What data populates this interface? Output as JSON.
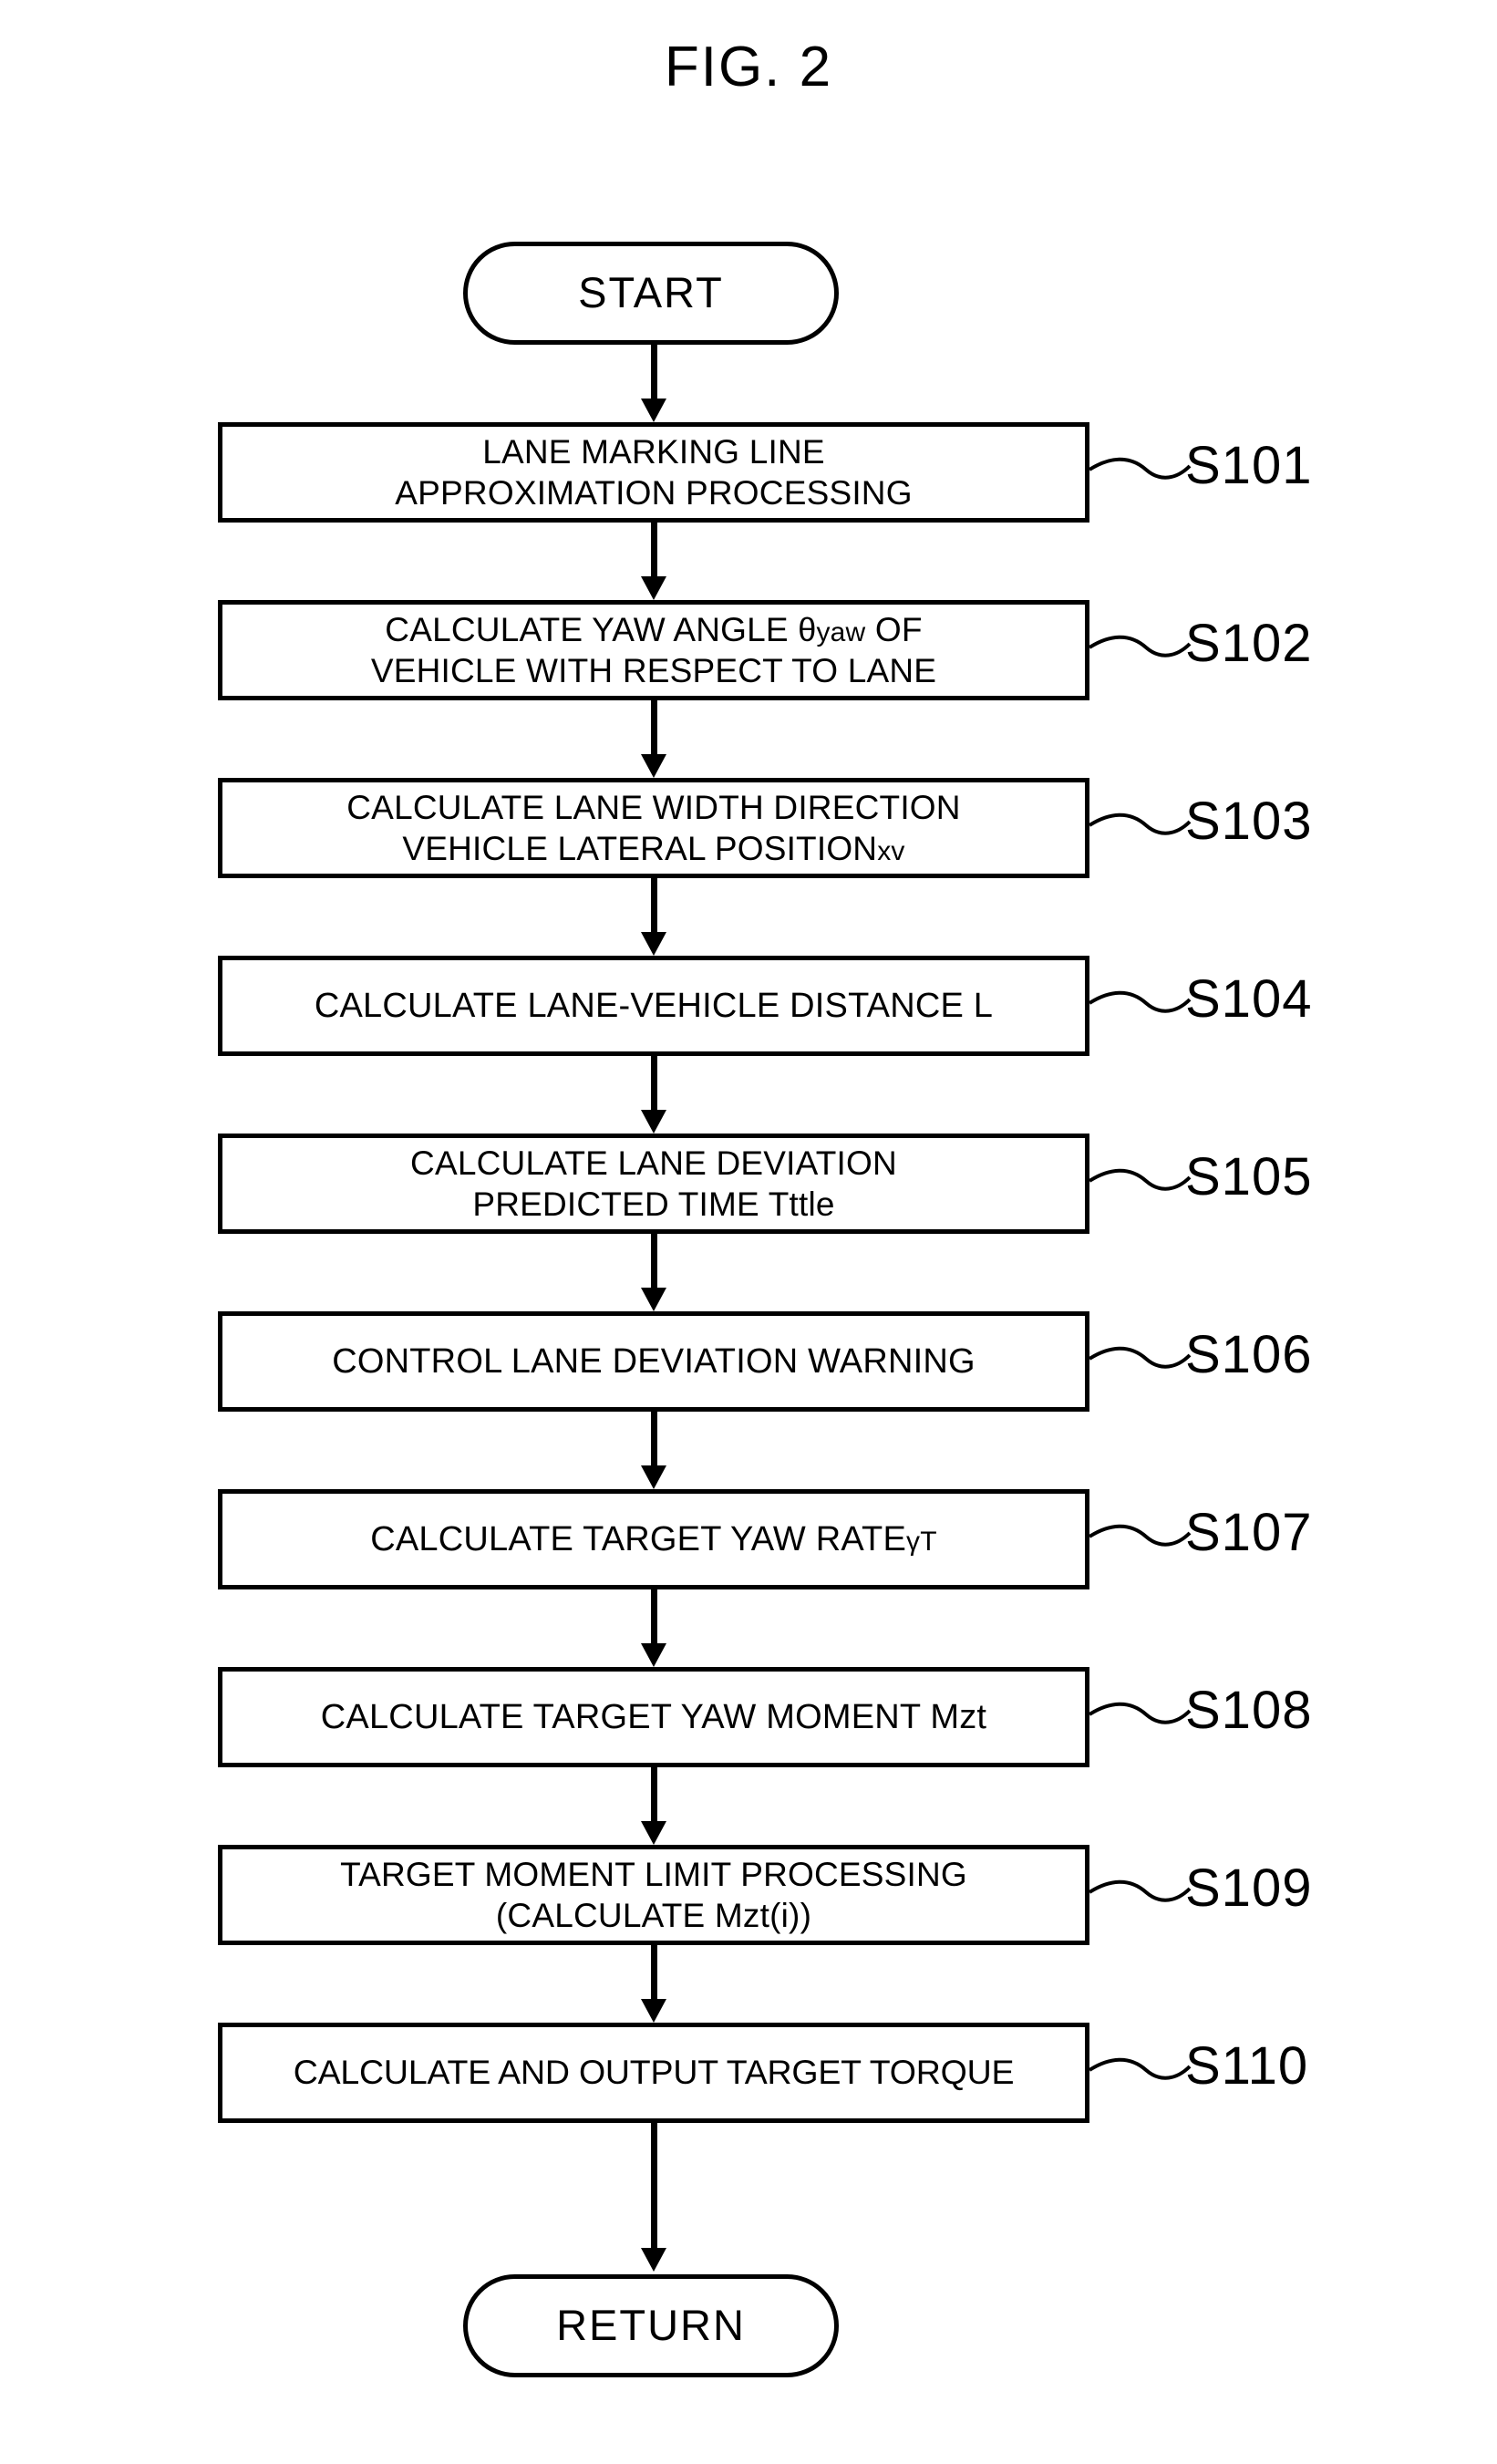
{
  "figure": {
    "title": "FIG. 2"
  },
  "flowchart": {
    "type": "flowchart",
    "orientation": "top-to-bottom",
    "start_label": "START",
    "end_label": "RETURN",
    "steps": [
      {
        "id": "S101",
        "lines": [
          "LANE MARKING LINE",
          "APPROXIMATION PROCESSING"
        ],
        "text": "LANE MARKING LINE APPROXIMATION PROCESSING"
      },
      {
        "id": "S102",
        "lines": [
          "CALCULATE YAW ANGLE θyaw OF",
          "VEHICLE WITH RESPECT TO LANE"
        ],
        "text": "CALCULATE YAW ANGLE θyaw OF VEHICLE WITH RESPECT TO LANE"
      },
      {
        "id": "S103",
        "lines": [
          "CALCULATE LANE WIDTH DIRECTION",
          "VEHICLE LATERAL POSITION xv"
        ],
        "text": "CALCULATE LANE WIDTH DIRECTION VEHICLE LATERAL POSITION xv"
      },
      {
        "id": "S104",
        "lines": [
          "CALCULATE LANE-VEHICLE DISTANCE L"
        ],
        "text": "CALCULATE LANE-VEHICLE DISTANCE L"
      },
      {
        "id": "S105",
        "lines": [
          "CALCULATE LANE DEVIATION",
          "PREDICTED TIME Tttle"
        ],
        "text": "CALCULATE LANE DEVIATION PREDICTED TIME Tttle"
      },
      {
        "id": "S106",
        "lines": [
          "CONTROL LANE DEVIATION WARNING"
        ],
        "text": "CONTROL LANE DEVIATION WARNING"
      },
      {
        "id": "S107",
        "lines": [
          "CALCULATE TARGET YAW RATE γT"
        ],
        "text": "CALCULATE TARGET YAW RATE γT"
      },
      {
        "id": "S108",
        "lines": [
          "CALCULATE TARGET YAW MOMENT Mzt"
        ],
        "text": "CALCULATE TARGET YAW MOMENT Mzt"
      },
      {
        "id": "S109",
        "lines": [
          "TARGET MOMENT LIMIT PROCESSING",
          "(CALCULATE Mzt(i))"
        ],
        "text": "TARGET MOMENT LIMIT PROCESSING (CALCULATE Mzt(i))"
      },
      {
        "id": "S110",
        "lines": [
          "CALCULATE AND OUTPUT TARGET TORQUE"
        ],
        "text": "CALCULATE AND OUTPUT TARGET TORQUE"
      }
    ]
  },
  "styles": {
    "stroke_color": "#000000",
    "background_color": "#ffffff"
  }
}
